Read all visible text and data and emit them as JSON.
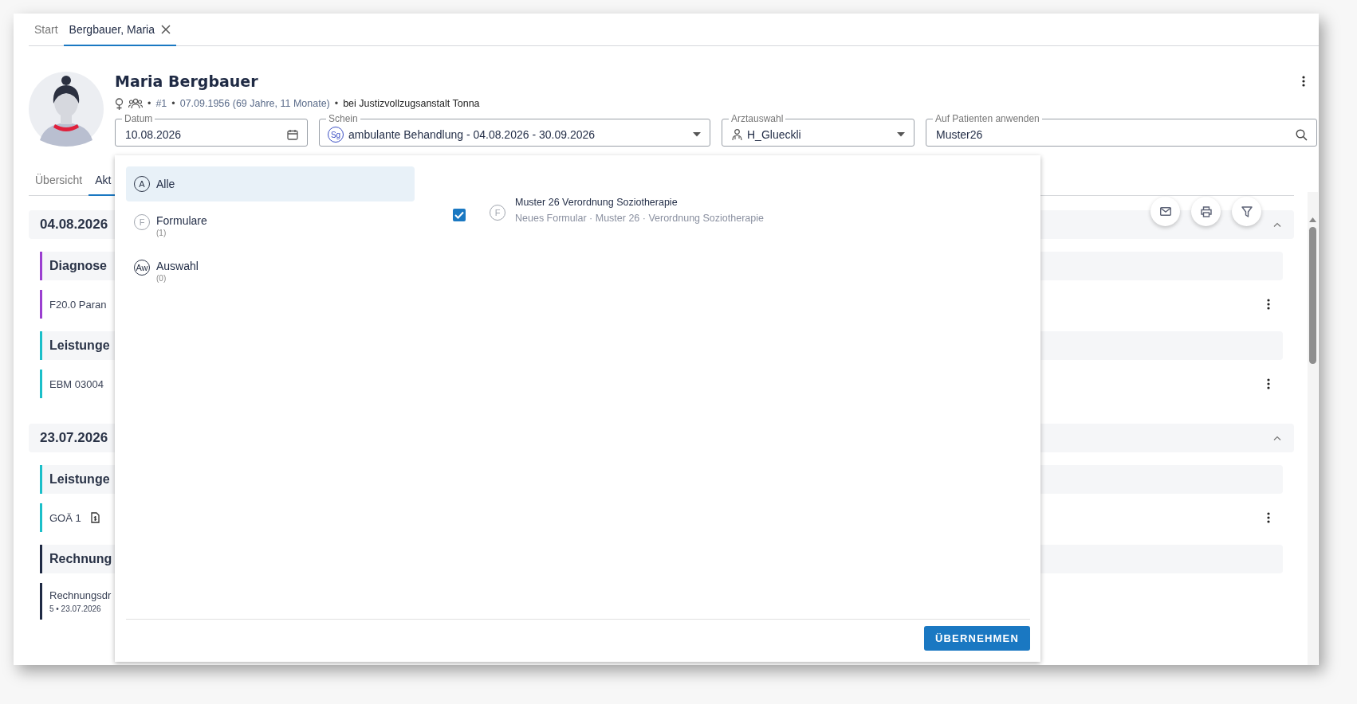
{
  "tabs": [
    {
      "label": "Start",
      "selected": false,
      "closable": false
    },
    {
      "label": "Bergbauer, Maria",
      "selected": true,
      "closable": true
    }
  ],
  "patient": {
    "name": "Maria Bergbauer",
    "meta": [
      {
        "kind": "sep",
        "text": "•"
      },
      {
        "kind": "muted",
        "text": "#1"
      },
      {
        "kind": "sep",
        "text": "•"
      },
      {
        "kind": "muted",
        "text": "07.09.1956 (69 Jahre, 11 Monate)"
      },
      {
        "kind": "sep",
        "text": "•"
      },
      {
        "kind": "strong",
        "text": "bei Justizvollzugsanstalt Tonna"
      }
    ]
  },
  "fields": [
    {
      "kind": "date",
      "label": "Datum",
      "value": "10.08.2026"
    },
    {
      "kind": "badge-select",
      "label": "Schein",
      "badge": "Sg",
      "value": "ambulante Behandlung - 04.08.2026 - 30.09.2026"
    },
    {
      "kind": "person-select",
      "label": "Arztauswahl",
      "value": "H_Glueckli"
    },
    {
      "kind": "search",
      "label": "Auf Patienten anwenden",
      "value": "Muster26"
    }
  ],
  "content_tabs": [
    {
      "label": "Übersicht",
      "selected": false
    },
    {
      "label": "Akt",
      "selected": true
    }
  ],
  "timeline": [
    {
      "date": "04.08.2026",
      "expanded": true,
      "sections": [
        {
          "title": "Diagnose",
          "color": "#9b3fd0",
          "entries": [
            {
              "text": "F20.0 Paran",
              "document": false,
              "menu": true
            }
          ]
        },
        {
          "title": "Leistunge",
          "color": "#1bbfc9",
          "entries": [
            {
              "text": "EBM 03004",
              "document": false,
              "menu": true
            }
          ]
        }
      ]
    },
    {
      "date": "23.07.2026",
      "expanded": true,
      "sections": [
        {
          "title": "Leistunge",
          "color": "#1bbfc9",
          "entries": [
            {
              "text": "GOÄ 1",
              "document": true,
              "menu": true
            }
          ]
        },
        {
          "title": "Rechnung",
          "color": "#1f2a44",
          "entries": [
            {
              "text": "Rechnungsdr",
              "detail": "5 • 23.07.2026",
              "document": false,
              "menu": false
            }
          ]
        }
      ]
    }
  ],
  "dropdown": {
    "categories": [
      {
        "badge": "A",
        "label": "Alle",
        "selected": true,
        "color": "#2b3447"
      },
      {
        "badge": "F",
        "label": "Formulare",
        "count": "(1)",
        "selected": false,
        "color": "#a0a5ae"
      },
      {
        "badge": "Aw",
        "label": "Auswahl",
        "count": "(0)",
        "selected": false,
        "color": "#2b3447"
      }
    ],
    "results": [
      {
        "checked": true,
        "badge": "F",
        "color": "#a0a5ae",
        "title": "Muster 26 Verordnung Soziotherapie",
        "subtitle": "Neues Formular · Muster 26 · Verordnung Soziotherapie"
      }
    ],
    "button": "ÜBERNEHMEN"
  }
}
